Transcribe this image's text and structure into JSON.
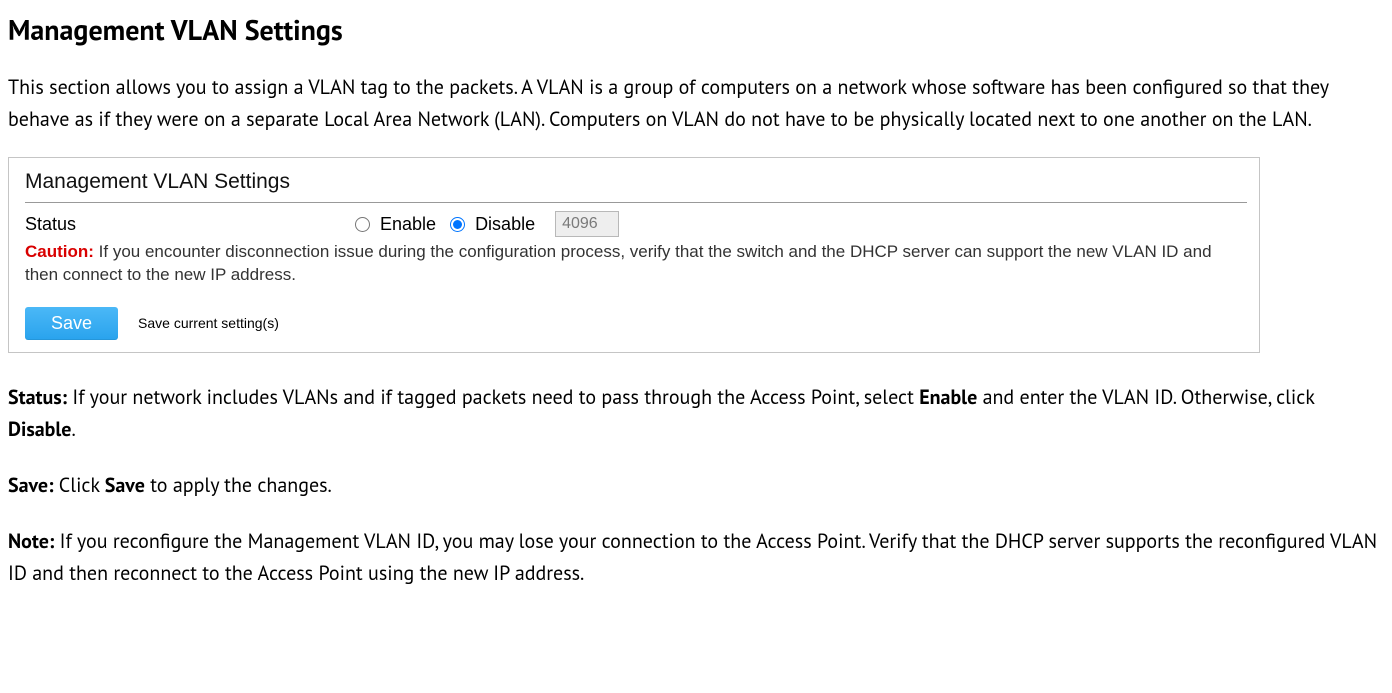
{
  "heading": "Management VLAN Settings",
  "intro": "This section allows you to assign a VLAN tag to the packets. A VLAN is a group of computers on a network whose software has been configured so that they behave as if they were on a separate Local Area Network (LAN). Computers on VLAN do not have to be physically located next to one another on the LAN.",
  "panel": {
    "title": "Management VLAN Settings",
    "status_label": "Status",
    "enable_label": "Enable",
    "disable_label": "Disable",
    "vlan_id_value": "4096",
    "caution_label": "Caution:",
    "caution_text": "If you encounter disconnection issue during the configuration process, verify that the switch and the DHCP server can support the new VLAN ID and then connect to the new IP address.",
    "save_button": "Save",
    "save_desc": "Save current setting(s)"
  },
  "status_para": {
    "label": "Status:",
    "pre": " If your network includes VLANs and if tagged packets need to pass through the Access Point, select ",
    "bold1": "Enable",
    "mid": " and enter the VLAN ID. Otherwise, click ",
    "bold2": "Disable",
    "post": "."
  },
  "save_para": {
    "label": "Save:",
    "pre": " Click ",
    "bold1": "Save",
    "post": " to apply the changes."
  },
  "note_para": {
    "label": "Note:",
    "text": " If you reconfigure the Management VLAN ID, you may lose your connection to the Access Point. Verify that the DHCP server supports the reconfigured VLAN ID and then reconnect to the Access Point using the new IP address."
  }
}
